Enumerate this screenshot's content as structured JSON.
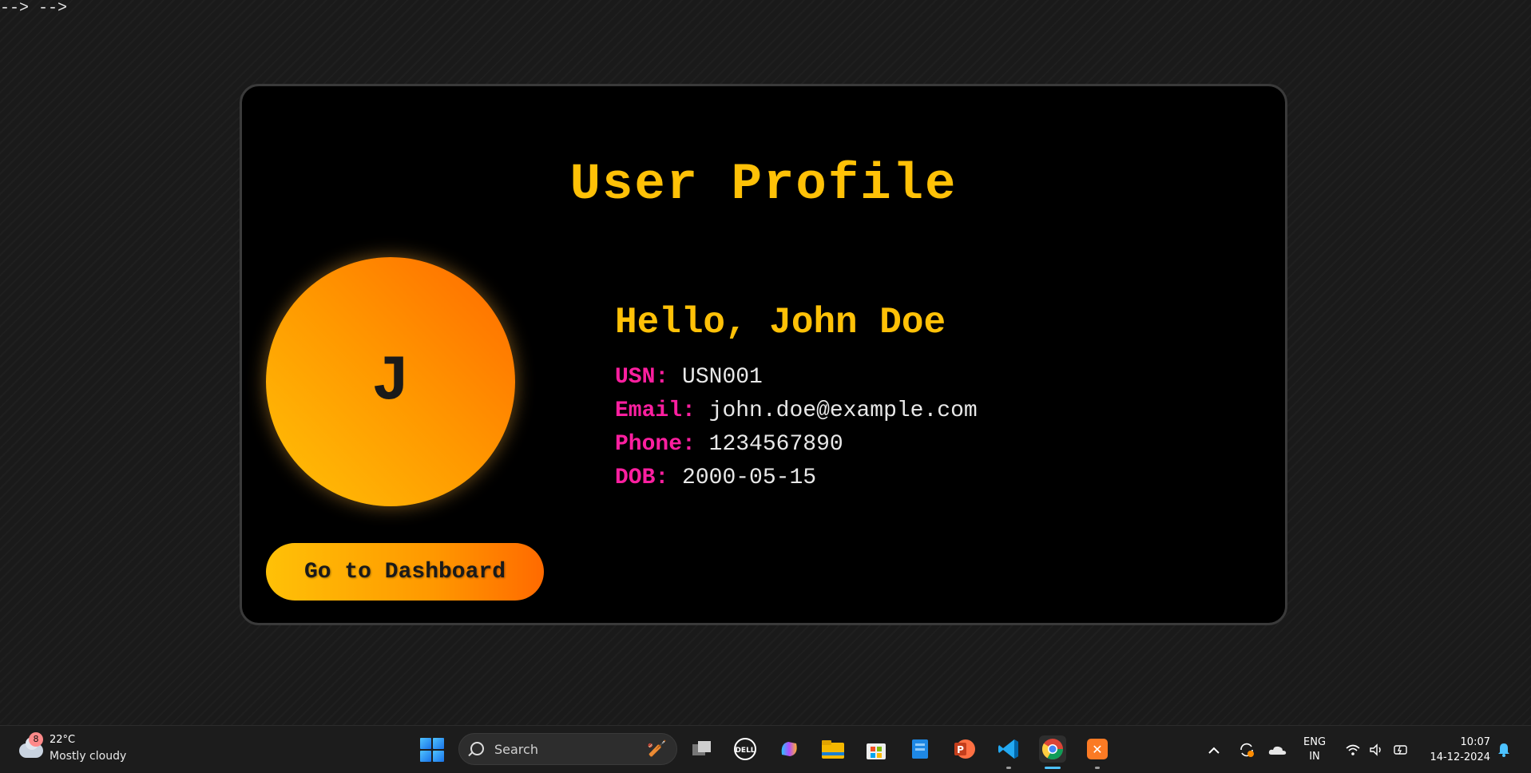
{
  "stray_text": "--> -->",
  "profile": {
    "title": "User Profile",
    "avatar_initial": "J",
    "greeting": "Hello, John Doe",
    "fields": [
      {
        "label": "USN:",
        "value": "USN001"
      },
      {
        "label": "Email:",
        "value": "john.doe@example.com"
      },
      {
        "label": "Phone:",
        "value": "1234567890"
      },
      {
        "label": "DOB:",
        "value": "2000-05-15"
      }
    ],
    "dashboard_button": "Go to Dashboard"
  },
  "colors": {
    "title": "#ffc107",
    "label": "#ff1fa0",
    "value": "#e8e8e8",
    "card_bg": "#000000"
  },
  "taskbar": {
    "weather": {
      "badge": "8",
      "temp": "22°C",
      "condition": "Mostly cloudy"
    },
    "search_placeholder": "Search",
    "apps": [
      "task-view",
      "dell",
      "copilot",
      "file-explorer",
      "microsoft-store",
      "app",
      "powerpoint",
      "vscode",
      "chrome",
      "xampp"
    ],
    "language": {
      "line1": "ENG",
      "line2": "IN"
    },
    "clock": {
      "time": "10:07",
      "date": "14-12-2024"
    }
  }
}
